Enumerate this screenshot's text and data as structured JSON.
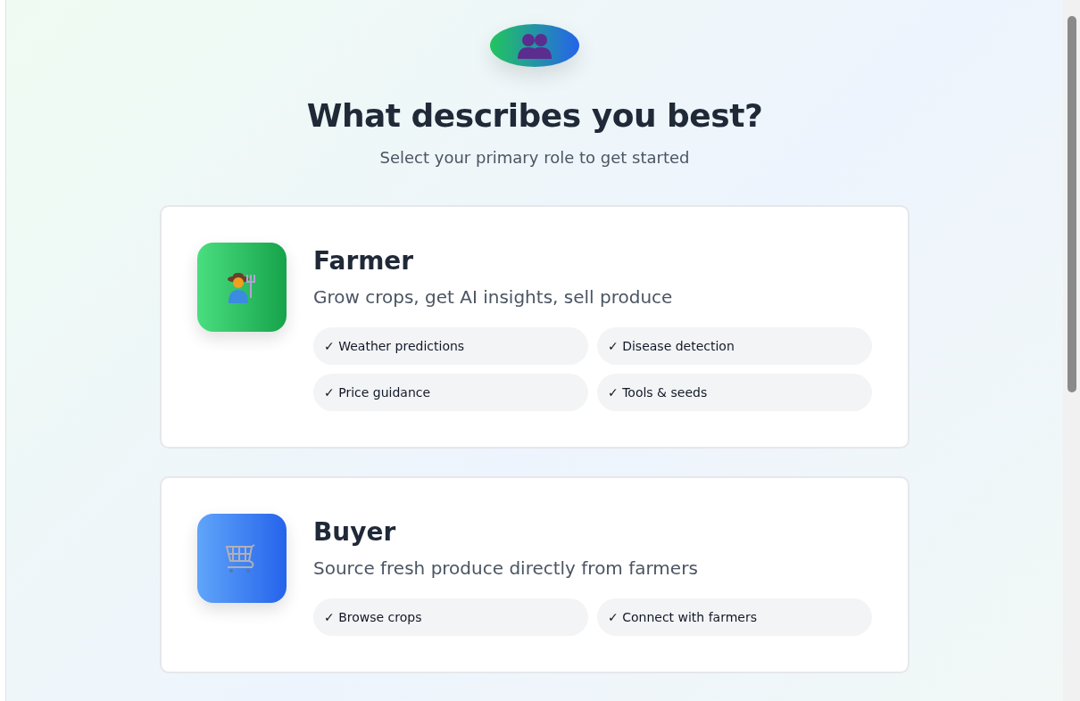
{
  "header": {
    "title": "What describes you best?",
    "subtitle": "Select your primary role to get started"
  },
  "roles": [
    {
      "kind": "farmer",
      "name": "Farmer",
      "description": "Grow crops, get AI insights, sell produce",
      "features": [
        "✓ Weather predictions",
        "✓ Disease detection",
        "✓ Price guidance",
        "✓ Tools & seeds"
      ]
    },
    {
      "kind": "buyer",
      "name": "Buyer",
      "description": "Source fresh produce directly from farmers",
      "features": [
        "✓ Browse crops",
        "✓ Connect with farmers"
      ]
    }
  ]
}
